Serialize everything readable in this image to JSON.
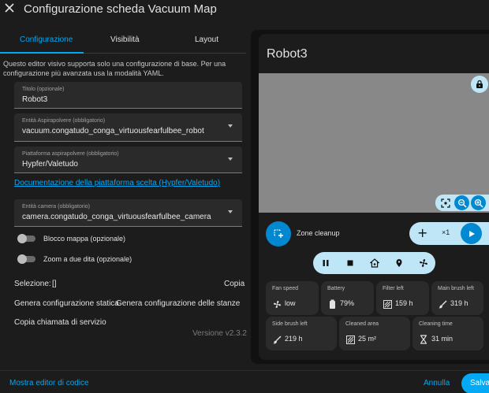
{
  "dialog": {
    "title": "Configurazione scheda Vacuum Map",
    "close_icon": "close-icon"
  },
  "tabs": [
    {
      "label": "Configurazione",
      "active": true
    },
    {
      "label": "Visibilità",
      "active": false
    },
    {
      "label": "Layout",
      "active": false
    }
  ],
  "editor": {
    "info": "Questo editor visivo supporta solo una configurazione di base. Per una configurazione più avanzata usa la modalità YAML.",
    "title_field": {
      "label": "Titolo (opzionale)",
      "value": "Robot3"
    },
    "entity_field": {
      "label": "Entità Aspirapolvere (obbligatorio)",
      "value": "vacuum.congatudo_conga_virtuousfearfulbee_robot"
    },
    "platform_field": {
      "label": "Piattaforma aspirapolvere (obbligatorio)",
      "value": "Hypfer/Valetudo"
    },
    "doc_link": "Documentazione della piattaforma scelta (Hypfer/Valetudo)",
    "camera_field": {
      "label": "Entità camera (obbligatorio)",
      "value": "camera.congatudo_conga_virtuousfearfulbee_camera"
    },
    "toggle_map_lock": {
      "label": "Blocco mappa (opzionale)",
      "on": false
    },
    "toggle_two_finger": {
      "label": "Zoom a due dita (opzionale)",
      "on": false
    },
    "selection_label": "Selezione:",
    "selection_value": "[]",
    "copy_label": "Copia",
    "gen_static": "Genera configurazione statica",
    "gen_rooms": "Genera configurazione delle stanze",
    "copy_service": "Copia chiamata di servizio",
    "version": "Versione v2.3.2"
  },
  "footer": {
    "show_code": "Mostra editor di codice",
    "cancel": "Annulla",
    "save": "Salva"
  },
  "preview": {
    "card_title": "Robot3",
    "zone_mode": "Zone cleanup",
    "repeats": "×1",
    "tiles": [
      {
        "label": "Fan speed",
        "icon": "fan-icon",
        "value": "low"
      },
      {
        "label": "Battery",
        "icon": "battery-icon",
        "value": "79%"
      },
      {
        "label": "Filter left",
        "icon": "filter-icon",
        "value": "159 h"
      },
      {
        "label": "Main brush left",
        "icon": "brush-icon",
        "value": "319 h"
      },
      {
        "label": "Side brush left",
        "icon": "side-brush-icon",
        "value": "219 h"
      },
      {
        "label": "Cleaned area",
        "icon": "area-icon",
        "value": "25 m²"
      },
      {
        "label": "Cleaning time",
        "icon": "timer-icon",
        "value": "31 min"
      }
    ]
  },
  "colors": {
    "accent": "#03a9f4",
    "button_dark": "#0288d1",
    "button_light": "#bfe6f7",
    "map": "#888888"
  }
}
